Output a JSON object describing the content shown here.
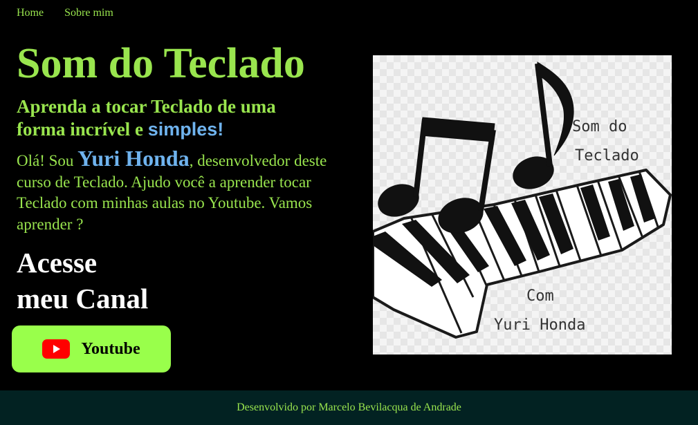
{
  "nav": {
    "items": [
      {
        "label": "Home"
      },
      {
        "label": "Sobre mim"
      }
    ]
  },
  "hero": {
    "title": "Som do Teclado",
    "subtitle_part1": "Aprenda a tocar Teclado de uma forma incrível e ",
    "subtitle_highlight": "simples!",
    "intro_part1": "Olá! Sou ",
    "intro_name": "Yuri Honda",
    "intro_part2": ", desenvolvedor deste curso de Teclado. Ajudo você a aprender tocar Teclado com minhas aulas no Youtube. Vamos aprender ?",
    "cta_line1": "Acesse",
    "cta_line2": "meu Canal",
    "youtube_label": "Youtube"
  },
  "logo": {
    "text_line1": "Som do",
    "text_line2": "Teclado",
    "text_line3": "Com",
    "text_line4": "Yuri Honda"
  },
  "footer": {
    "text": "Desenvolvido por Marcelo Bevilacqua de Andrade"
  },
  "colors": {
    "background": "#000000",
    "accent_green": "#99e54e",
    "button_green": "#99ff4b",
    "accent_blue": "#6fb3ee",
    "footer_bg": "#022222",
    "youtube_red": "#ff0000"
  },
  "icons": {
    "youtube": "youtube-icon"
  }
}
